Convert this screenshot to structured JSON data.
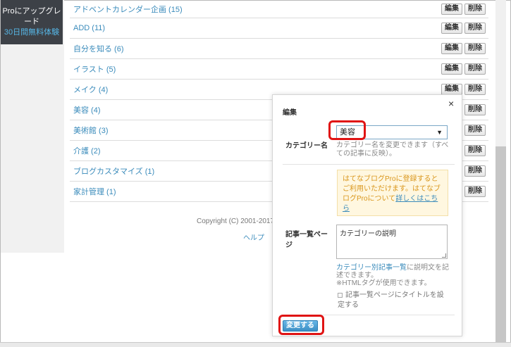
{
  "promo": {
    "line1": "Proにアップグレード",
    "line2": "30日間無料体験"
  },
  "categories": [
    {
      "name": "アドベントカレンダー企画 (15)"
    },
    {
      "name": "ADD (11)"
    },
    {
      "name": "自分を知る (6)"
    },
    {
      "name": "イラスト (5)"
    },
    {
      "name": "メイク (4)"
    },
    {
      "name": "美容 (4)"
    },
    {
      "name": "美術館 (3)"
    },
    {
      "name": "介護 (2)"
    },
    {
      "name": "ブログカスタマイズ (1)"
    },
    {
      "name": "家計管理 (1)"
    }
  ],
  "row_buttons": {
    "edit": "編集",
    "delete": "削除"
  },
  "footer": {
    "copyright": "Copyright (C) 2001-2017",
    "help": "ヘルプ"
  },
  "dialog": {
    "title": "編集",
    "close": "×",
    "category_label": "カテゴリー名",
    "category_value": "美容",
    "category_hint": "カテゴリー名を変更できます（すべての記事に反映）。",
    "pro_text_1": "はてなブログProに登録するとご利用いただけます。はてなブログProについて",
    "pro_link": "詳しくはこちら",
    "page_label": "記事一覧ページ",
    "description_value": "カテゴリーの説明",
    "desc_link": "カテゴリー別記事一覧",
    "desc_note_1": "に説明文を記述できます。",
    "desc_note_2": "※HTMLタグが使用できます。",
    "checkbox_label": "記事一覧ページにタイトルを設定する",
    "submit": "変更する"
  },
  "colors": {
    "link": "#3a8bbb",
    "highlight": "#e01414",
    "promo_bg": "#3d4147",
    "submit": "#3c8fc5"
  }
}
